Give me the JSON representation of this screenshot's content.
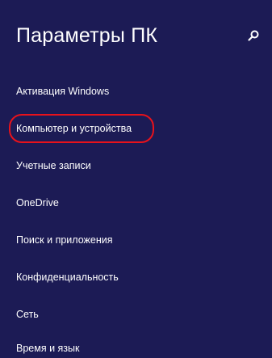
{
  "header": {
    "title": "Параметры ПК",
    "search_icon": "search-icon"
  },
  "menu": {
    "items": [
      {
        "label": "Активация Windows"
      },
      {
        "label": "Компьютер и устройства",
        "highlighted": true
      },
      {
        "label": "Учетные записи"
      },
      {
        "label": "OneDrive"
      },
      {
        "label": "Поиск и приложения"
      },
      {
        "label": "Конфиденциальность"
      },
      {
        "label": "Сеть"
      },
      {
        "label": "Время и язык"
      }
    ]
  },
  "colors": {
    "background": "#1c1b55",
    "text": "#ffffff",
    "highlight": "#e8121b"
  }
}
